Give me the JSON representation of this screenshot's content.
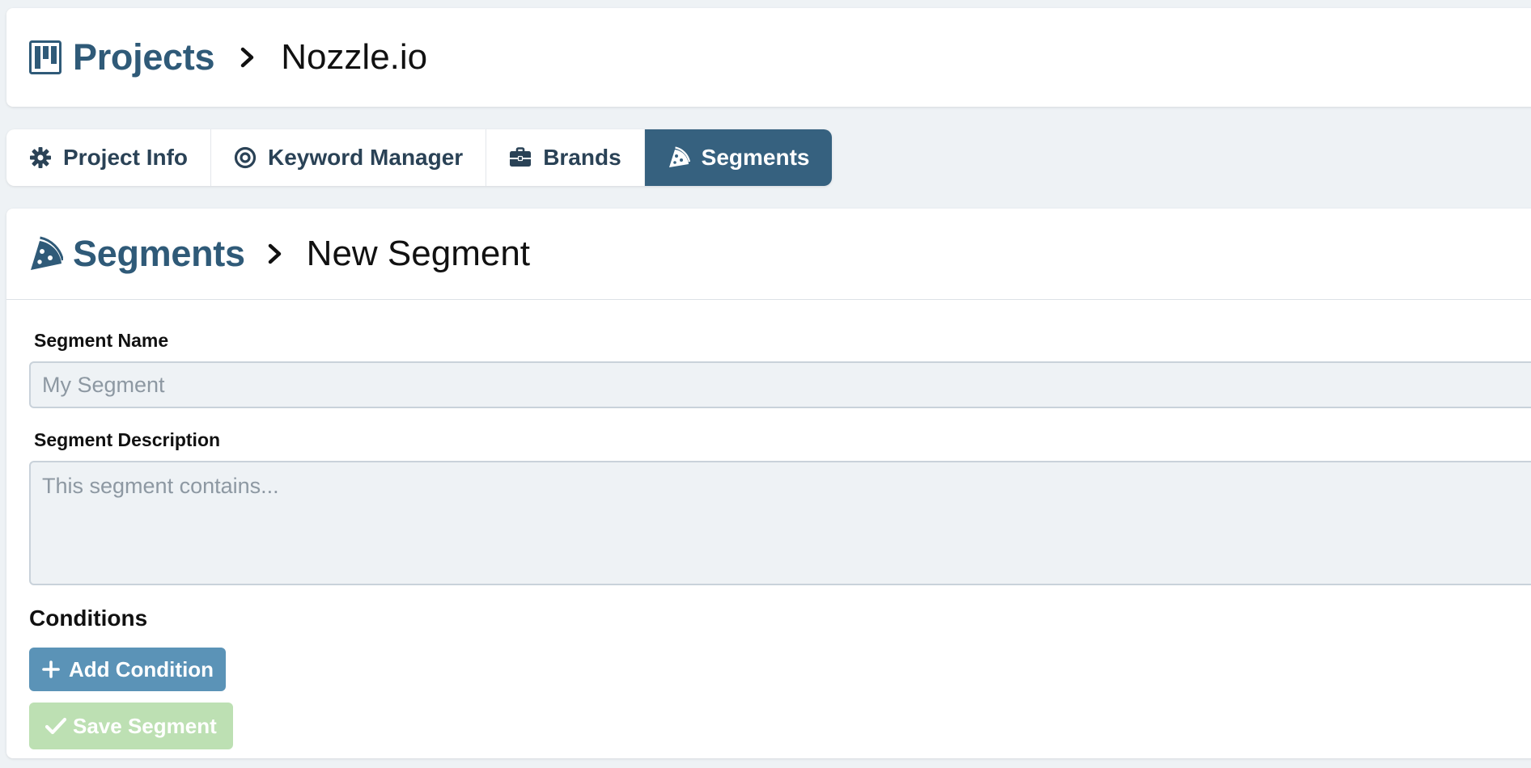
{
  "header": {
    "root_label": "Projects",
    "current_label": "Nozzle.io",
    "root_icon": "kanban-board-icon",
    "separator_icon": "chevron-right-icon"
  },
  "tabs": [
    {
      "label": "Project Info",
      "icon": "gear-icon",
      "active": false
    },
    {
      "label": "Keyword Manager",
      "icon": "target-icon",
      "active": false
    },
    {
      "label": "Brands",
      "icon": "briefcase-icon",
      "active": false
    },
    {
      "label": "Segments",
      "icon": "pizza-slice-icon",
      "active": true
    }
  ],
  "main": {
    "breadcrumb": {
      "root_label": "Segments",
      "current_label": "New Segment",
      "root_icon": "pizza-slice-icon"
    },
    "form": {
      "name_label": "Segment Name",
      "name_value": "",
      "name_placeholder": "My Segment",
      "description_label": "Segment Description",
      "description_value": "",
      "description_placeholder": "This segment contains...",
      "conditions_title": "Conditions",
      "add_condition_label": "Add Condition",
      "save_label": "Save Segment"
    }
  },
  "colors": {
    "brand": "#2f5a78",
    "active_tab_bg": "#36617f",
    "add_button_bg": "#5b93b7",
    "save_button_bg_disabled": "#bde0b3",
    "page_bg": "#eef2f5"
  }
}
